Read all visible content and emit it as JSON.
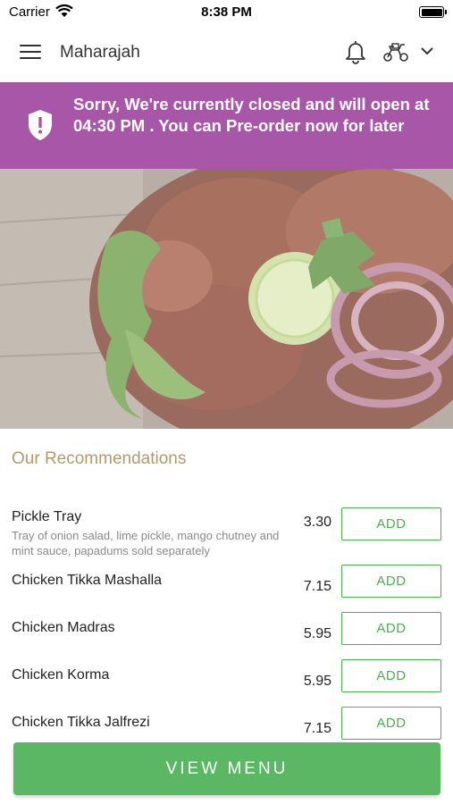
{
  "status_bar": {
    "carrier": "Carrier",
    "time": "8:38 PM"
  },
  "header": {
    "title": "Maharajah",
    "icons": [
      "menu-icon",
      "bell-icon",
      "scooter-icon",
      "chevron-down-icon"
    ]
  },
  "banner": {
    "message": "Sorry, We're currently closed and will open at 04:30 PM . You can Pre-order now for later",
    "color": "#a856a8",
    "icon": "shield-icon"
  },
  "hero": {
    "icon": "food-photo"
  },
  "recommendations": {
    "title": "Our Recommendations",
    "items": [
      {
        "name": "Pickle Tray",
        "description": "Tray of onion salad, lime pickle, mango chutney and mint sauce, papadums sold separately",
        "price": "3.30",
        "button": "ADD"
      },
      {
        "name": "Chicken Tikka Mashalla",
        "description": "",
        "price": "7.15",
        "button": "ADD"
      },
      {
        "name": "Chicken Madras",
        "description": "",
        "price": "5.95",
        "button": "ADD"
      },
      {
        "name": "Chicken Korma",
        "description": "",
        "price": "5.95",
        "button": "ADD"
      },
      {
        "name": "Chicken Tikka Jalfrezi",
        "description": "",
        "price": "7.15",
        "button": "ADD"
      }
    ]
  },
  "footer": {
    "view_menu": "VIEW MENU"
  },
  "colors": {
    "accent_green": "#4caf50",
    "section_title": "#b19a6b"
  }
}
